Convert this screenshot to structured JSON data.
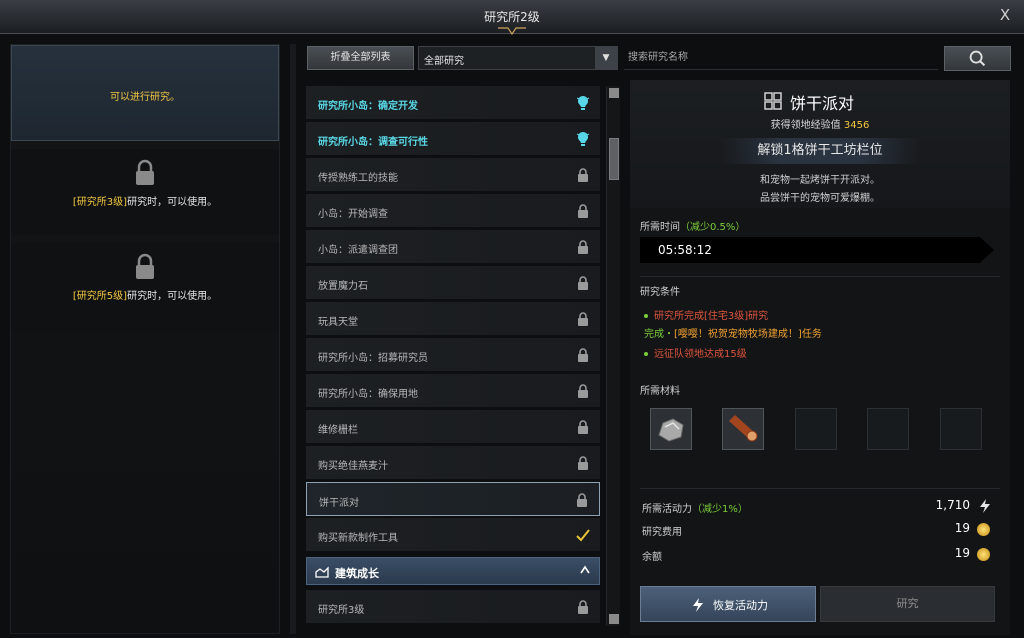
{
  "window": {
    "title": "研究所2级",
    "close": "X"
  },
  "left_panel": {
    "slot1": {
      "text": "可以进行研究。"
    },
    "slot2": {
      "highlight": "[研究所3级]",
      "text": "研究时，可以使用。"
    },
    "slot3": {
      "highlight": "[研究所5级]",
      "text": "研究时，可以使用。"
    }
  },
  "toolbar": {
    "collapse_label": "折叠全部列表",
    "filter_value": "全部研究",
    "search_placeholder": "搜索研究名称"
  },
  "list": {
    "items": [
      {
        "label": "研究所小岛：确定开发",
        "state": "available",
        "icon": "lightbulb-icon"
      },
      {
        "label": "研究所小岛：调查可行性",
        "state": "available",
        "icon": "lightbulb-icon"
      },
      {
        "label": "传授熟练工的技能",
        "state": "locked",
        "icon": "lock-icon"
      },
      {
        "label": "小岛：开始调查",
        "state": "locked",
        "icon": "lock-icon"
      },
      {
        "label": "小岛：派遣调查团",
        "state": "locked",
        "icon": "lock-icon"
      },
      {
        "label": "放置魔力石",
        "state": "locked",
        "icon": "lock-icon"
      },
      {
        "label": "玩具天堂",
        "state": "locked",
        "icon": "lock-icon"
      },
      {
        "label": "研究所小岛：招募研究员",
        "state": "locked",
        "icon": "lock-icon"
      },
      {
        "label": "研究所小岛：确保用地",
        "state": "locked",
        "icon": "lock-icon"
      },
      {
        "label": "维修栅栏",
        "state": "locked",
        "icon": "lock-icon"
      },
      {
        "label": "购买绝佳燕麦汁",
        "state": "locked",
        "icon": "lock-icon"
      },
      {
        "label": "饼干派对",
        "state": "selected",
        "icon": "lock-icon"
      },
      {
        "label": "购买新款制作工具",
        "state": "done",
        "icon": "checkmark-icon"
      }
    ],
    "category": {
      "label": "建筑成长",
      "icon": "building-icon"
    },
    "after_category": [
      {
        "label": "研究所3级",
        "state": "locked",
        "icon": "lock-icon"
      }
    ]
  },
  "detail": {
    "name": "饼干派对",
    "exp_label": "获得领地经验值",
    "exp_value": "3456",
    "unlock": "解锁1格饼干工坊栏位",
    "desc_line1": "和宠物一起烤饼干开派对。",
    "desc_line2": "品尝饼干的宠物可爱爆棚。",
    "time_label": "所需时间",
    "time_reduce": "（减少0.5%）",
    "time_value": "05:58:12",
    "conditions_label": "研究条件",
    "condition1": "研究所完成[住宅3级]研究",
    "condition2_prefix": "完成・",
    "condition2_quest": "[嘤嘤！祝贺宠物牧场建成！]",
    "condition2_suffix": "任务",
    "condition3": "远征队领地达成15级",
    "materials_label": "所需材料",
    "energy_label": "所需活动力",
    "energy_reduce": "（减少1%）",
    "energy_value": "1,710",
    "cost_label": "研究费用",
    "cost_value": "19",
    "balance_label": "余额",
    "balance_value": "19",
    "restore_label": "恢复活动力",
    "research_label": "研究"
  },
  "colors": {
    "accent": "#f4c842",
    "available": "#5ad8e6",
    "green": "#7ccd3a",
    "red": "#e0553d"
  }
}
